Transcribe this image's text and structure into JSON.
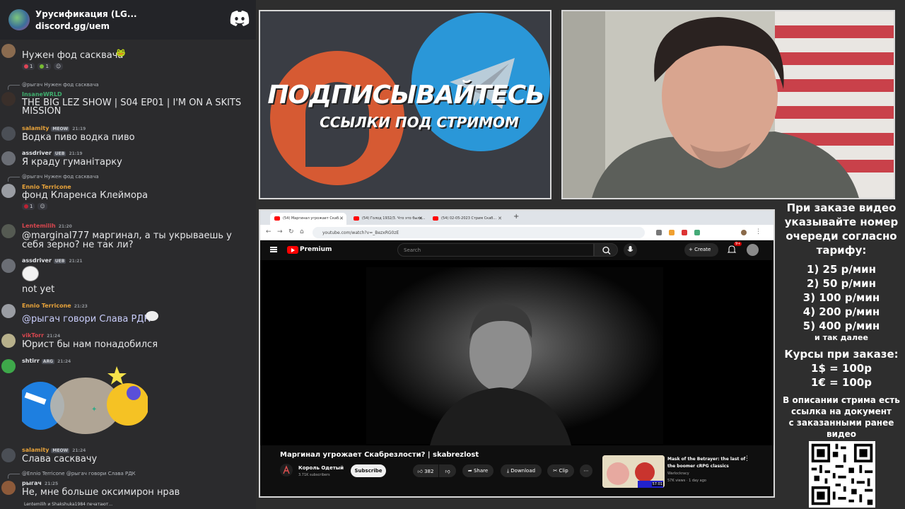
{
  "discord": {
    "server_name": "Урусификация (LG...",
    "invite": "discord.gg/uem",
    "messages": [
      {
        "text": "Нужен фод сасквача",
        "reactions": [
          {
            "count": "1"
          },
          {
            "count": "1"
          }
        ]
      },
      {
        "reply": "@рыгач Нужен фод сасквача",
        "user": "InsaneWRLD",
        "text": "THE BIG LEZ SHOW | S04 EP01 | I'M ON A SKITS MISSION"
      },
      {
        "user": "salamity",
        "tag": "MEOW",
        "time": "21:19",
        "text": "Водка пиво водка пиво"
      },
      {
        "user": "assdriver",
        "tag": "UEB",
        "time": "21:19",
        "text": "Я краду гуманітарку"
      },
      {
        "reply": "@рыгач Нужен фод сасквача",
        "user": "Ennio Terricone",
        "text": "фонд Кларенса Клеймора",
        "reactions": [
          {
            "count": "1"
          }
        ]
      },
      {
        "user": "Lentemilih",
        "time": "21:20",
        "text": "@marginal777 маргинал, а ты укрываешь у себя зерно? не так ли?"
      },
      {
        "user": "assdriver",
        "tag": "UEB",
        "time": "21:21",
        "text": "not yet"
      },
      {
        "user": "Ennio Terricone",
        "time": "21:23",
        "text": "@рыгач говори Слава РДК"
      },
      {
        "user": "vikTorr",
        "time": "21:24",
        "text": "Юрист бы нам понадобился"
      },
      {
        "user": "shtirr",
        "tag": "ARG",
        "time": "21:24"
      },
      {
        "user": "salamity",
        "tag": "MEOW",
        "time": "21:24",
        "text": "Слава сасквачу"
      },
      {
        "reply": "@Ennio Terricone @рыгач говори Слава РДК",
        "user": "рыгач",
        "time": "21:25",
        "text": "Не, мне больше оксимирон нрав"
      }
    ],
    "typing": "Lentemilih и Shakshuka1984 печатают..."
  },
  "promo": {
    "line1": "ПОДПИСЫВАЙТЕСЬ",
    "line2": "ССЫЛКИ ПОД СТРИМОМ"
  },
  "browser": {
    "tabs": [
      {
        "label": "(54) Маргинал угрожает Скаб..."
      },
      {
        "label": "(54) Голод 1932/3. Что это было..."
      },
      {
        "label": "(54) 02-05-2023 Стрим Скаб..."
      }
    ],
    "url": "youtube.com/watch?v=_BezxRG0zE",
    "youtube": {
      "brand": "Premium",
      "search_placeholder": "Search",
      "create_label": "Create",
      "notifications": "9+",
      "video_title": "Маргинал угрожает Скабрезлости? | skabrezlost",
      "channel": "Король Одетый",
      "subscribers": "3.71K subscribers",
      "subscribe_label": "Subscribe",
      "likes": "382",
      "share_label": "Share",
      "download_label": "Download",
      "clip_label": "Clip",
      "recommended": {
        "title": "Mask of the Betrayer: the last of the boomer cRPG classics",
        "channel": "Warlockracy",
        "meta": "57K views · 1 day ago",
        "duration": "57:01"
      }
    }
  },
  "info": {
    "heading": [
      "При заказе видео",
      "указывайте номер",
      "очереди согласно",
      "тарифу:"
    ],
    "tariffs": [
      "1) 25 р/мин",
      "2) 50 р/мин",
      "3) 100 р/мин",
      "4) 200 р/мин",
      "5) 400 р/мин"
    ],
    "etc": "и так далее",
    "rates_title": "Курсы при заказе:",
    "rates": [
      "1$ = 100р",
      "1€ = 100р"
    ],
    "note": [
      "В описании стрима есть",
      "ссылка на документ",
      "с заказанными ранее",
      "видео"
    ]
  },
  "colors": {
    "discord_bg": "#2b2b2d",
    "promo_orange": "#d65a33",
    "telegram_blue": "#2a97d8",
    "youtube_red": "#ff0000"
  }
}
